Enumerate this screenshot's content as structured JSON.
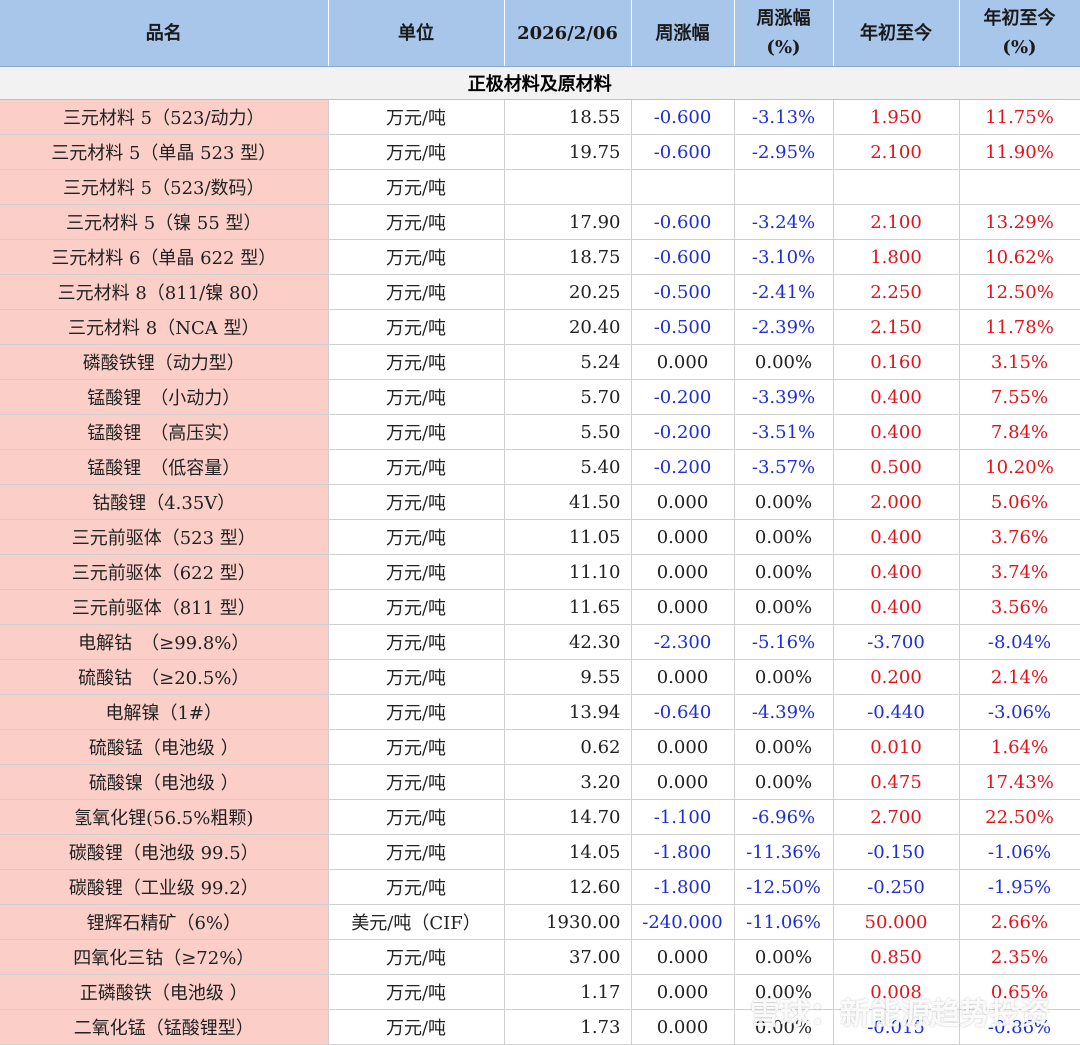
{
  "headers": [
    "品名",
    "单位",
    "2026/2/06",
    "周涨幅",
    "周涨幅\n(%)",
    "年初至今",
    "年初至今\n(%)"
  ],
  "section_title": "正极材料及原材料",
  "rows": [
    [
      "三元材料 5（523/动力）",
      "万元/吨",
      "18.55",
      "-0.600",
      "-3.13%",
      "1.950",
      "11.75%"
    ],
    [
      "三元材料 5（单晶 523 型）",
      "万元/吨",
      "19.75",
      "-0.600",
      "-2.95%",
      "2.100",
      "11.90%"
    ],
    [
      "三元材料 5（523/数码）",
      "万元/吨",
      "",
      "",
      "",
      "",
      ""
    ],
    [
      "三元材料 5（镍 55 型）",
      "万元/吨",
      "17.90",
      "-0.600",
      "-3.24%",
      "2.100",
      "13.29%"
    ],
    [
      "三元材料 6（单晶 622 型）",
      "万元/吨",
      "18.75",
      "-0.600",
      "-3.10%",
      "1.800",
      "10.62%"
    ],
    [
      "三元材料 8（811/镍 80）",
      "万元/吨",
      "20.25",
      "-0.500",
      "-2.41%",
      "2.250",
      "12.50%"
    ],
    [
      "三元材料 8（NCA 型）",
      "万元/吨",
      "20.40",
      "-0.500",
      "-2.39%",
      "2.150",
      "11.78%"
    ],
    [
      "磷酸铁锂（动力型）",
      "万元/吨",
      "5.24",
      "0.000",
      "0.00%",
      "0.160",
      "3.15%"
    ],
    [
      "锰酸锂　（小动力）",
      "万元/吨",
      "5.70",
      "-0.200",
      "-3.39%",
      "0.400",
      "7.55%"
    ],
    [
      "锰酸锂　（高压实）",
      "万元/吨",
      "5.50",
      "-0.200",
      "-3.51%",
      "0.400",
      "7.84%"
    ],
    [
      "锰酸锂　（低容量）",
      "万元/吨",
      "5.40",
      "-0.200",
      "-3.57%",
      "0.500",
      "10.20%"
    ],
    [
      "钴酸锂（4.35V）",
      "万元/吨",
      "41.50",
      "0.000",
      "0.00%",
      "2.000",
      "5.06%"
    ],
    [
      "三元前驱体（523 型）",
      "万元/吨",
      "11.05",
      "0.000",
      "0.00%",
      "0.400",
      "3.76%"
    ],
    [
      "三元前驱体（622 型）",
      "万元/吨",
      "11.10",
      "0.000",
      "0.00%",
      "0.400",
      "3.74%"
    ],
    [
      "三元前驱体（811 型）",
      "万元/吨",
      "11.65",
      "0.000",
      "0.00%",
      "0.400",
      "3.56%"
    ],
    [
      "电解钴　（≥99.8%）",
      "万元/吨",
      "42.30",
      "-2.300",
      "-5.16%",
      "-3.700",
      "-8.04%"
    ],
    [
      "硫酸钴　（≥20.5%）",
      "万元/吨",
      "9.55",
      "0.000",
      "0.00%",
      "0.200",
      "2.14%"
    ],
    [
      "电解镍（1#）",
      "万元/吨",
      "13.94",
      "-0.640",
      "-4.39%",
      "-0.440",
      "-3.06%"
    ],
    [
      "硫酸锰（电池级 ）",
      "万元/吨",
      "0.62",
      "0.000",
      "0.00%",
      "0.010",
      "1.64%"
    ],
    [
      "硫酸镍（电池级 ）",
      "万元/吨",
      "3.20",
      "0.000",
      "0.00%",
      "0.475",
      "17.43%"
    ],
    [
      "氢氧化锂(56.5%粗颗)",
      "万元/吨",
      "14.70",
      "-1.100",
      "-6.96%",
      "2.700",
      "22.50%"
    ],
    [
      "碳酸锂（电池级 99.5）",
      "万元/吨",
      "14.05",
      "-1.800",
      "-11.36%",
      "-0.150",
      "-1.06%"
    ],
    [
      "碳酸锂（工业级 99.2）",
      "万元/吨",
      "12.60",
      "-1.800",
      "-12.50%",
      "-0.250",
      "-1.95%"
    ],
    [
      "锂辉石精矿（6%）",
      "美元/吨（CIF）",
      "1930.00",
      "-240.000",
      "-11.06%",
      "50.000",
      "2.66%"
    ],
    [
      "四氧化三钴（≥72%）",
      "万元/吨",
      "37.00",
      "0.000",
      "0.00%",
      "0.850",
      "2.35%"
    ],
    [
      "正磷酸铁（电池级 ）",
      "万元/吨",
      "1.17",
      "0.000",
      "0.00%",
      "0.008",
      "0.65%"
    ],
    [
      "二氧化锰（锰酸锂型）",
      "万元/吨",
      "1.73",
      "0.000",
      "0.00%",
      "-0.015",
      "-0.86%"
    ]
  ],
  "colors": {
    "header_bg": "#a8c5ea",
    "name_bg": "#fbcfc8",
    "negative": "#1f2fd6",
    "positive": "#e0141b"
  },
  "watermark": "雪球：新能源趋势投资"
}
